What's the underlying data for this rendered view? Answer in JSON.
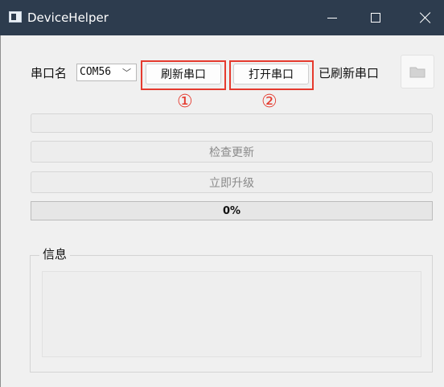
{
  "window": {
    "title": "DeviceHelper",
    "controls": {
      "minimize_icon": "minimize-icon",
      "maximize_icon": "maximize-icon",
      "close_icon": "close-icon"
    }
  },
  "serial": {
    "port_label": "串口名",
    "port_value": "COM56",
    "refresh_button": "刷新串口",
    "open_button": "打开串口",
    "status": "已刷新串口"
  },
  "annotations": {
    "one": "①",
    "two": "②",
    "highlight_color": "#e53a2e"
  },
  "actions": {
    "check_update": "检查更新",
    "upgrade_now": "立即升级"
  },
  "progress": {
    "value": 0,
    "text": "0%"
  },
  "info": {
    "title": "信息",
    "content": ""
  },
  "colors": {
    "titlebar": "#2d3c4e",
    "background": "#f0f0f0"
  }
}
